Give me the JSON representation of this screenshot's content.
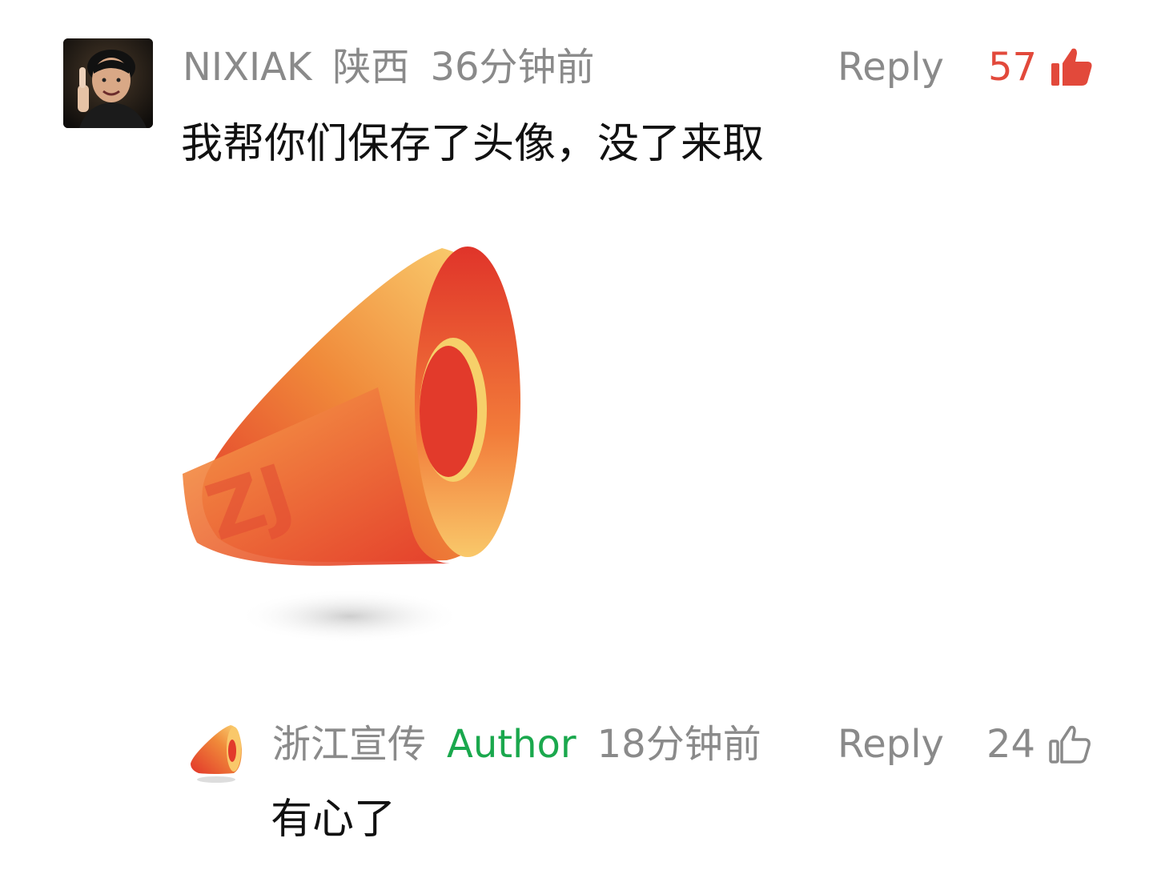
{
  "comment": {
    "username": "NIXIAK",
    "location": "陕西",
    "time": "36分钟前",
    "reply_label": "Reply",
    "like_count": "57",
    "liked": true,
    "text": "我帮你们保存了头像，没了来取",
    "image_logo_text": "ZJ",
    "accent_color": "#e2493b"
  },
  "reply": {
    "username": "浙江宣传",
    "author_tag": "Author",
    "time": "18分钟前",
    "reply_label": "Reply",
    "like_count": "24",
    "liked": false,
    "text": "有心了",
    "author_color": "#1aa84d"
  },
  "icons": {
    "like_filled": "thumbs-up-filled-icon",
    "like_outline": "thumbs-up-outline-icon"
  }
}
